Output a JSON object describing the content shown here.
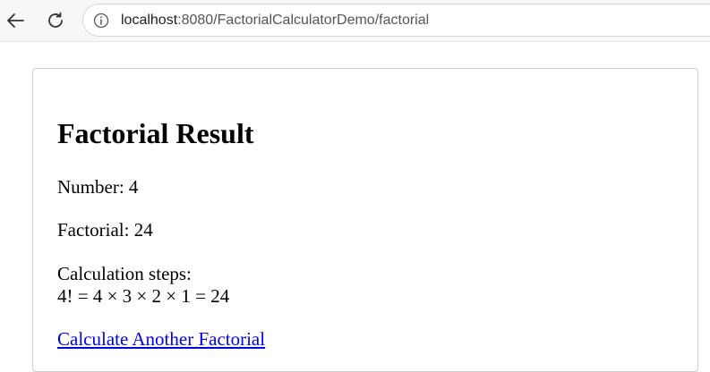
{
  "browser": {
    "url_host": "localhost",
    "url_rest": ":8080/FactorialCalculatorDemo/factorial",
    "icons": {
      "back": "back-arrow-icon",
      "reload": "reload-icon",
      "info": "info-icon"
    }
  },
  "result": {
    "title": "Factorial Result",
    "number_label": "Number:",
    "number_value": "4",
    "factorial_label": "Factorial:",
    "factorial_value": "24",
    "steps_label": "Calculation steps:",
    "steps_expression": "4! = 4 × 3 × 2 × 1 = 24",
    "again_link": "Calculate Another Factorial"
  }
}
